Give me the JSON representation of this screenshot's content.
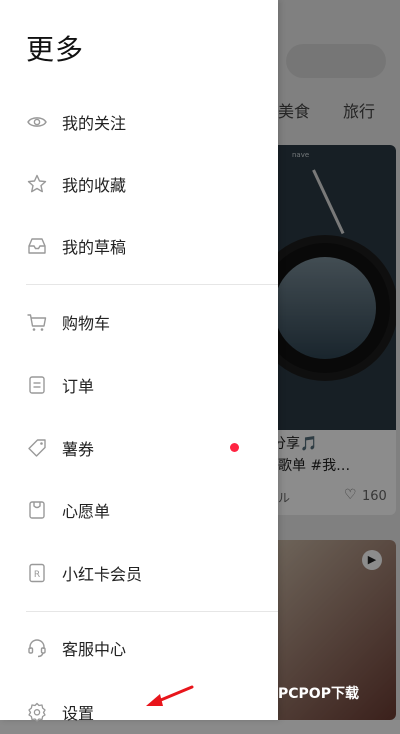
{
  "drawer": {
    "title": "更多",
    "items": [
      {
        "label": "我的关注",
        "icon": "eye-icon"
      },
      {
        "label": "我的收藏",
        "icon": "star-icon"
      },
      {
        "label": "我的草稿",
        "icon": "inbox-tray-icon"
      },
      {
        "label": "购物车",
        "icon": "cart-icon"
      },
      {
        "label": "订单",
        "icon": "order-doc-icon"
      },
      {
        "label": "薯券",
        "icon": "coupon-tag-icon",
        "badge": "red-dot"
      },
      {
        "label": "心愿单",
        "icon": "wishlist-bag-icon"
      },
      {
        "label": "小红卡会员",
        "icon": "r-card-icon"
      },
      {
        "label": "客服中心",
        "icon": "headset-icon"
      },
      {
        "label": "设置",
        "icon": "gear-icon"
      }
    ]
  },
  "background": {
    "tabs": [
      "美食",
      "旅行"
    ],
    "card_title": "分享🎵",
    "card_subtitle": "歌单 #我…",
    "card_author": "ル",
    "card_likes": "160",
    "vinyl_label": "nave"
  },
  "watermark": "PCPOP下载",
  "colors": {
    "badge_red": "#ff2442",
    "arrow_red": "#e8151b"
  }
}
